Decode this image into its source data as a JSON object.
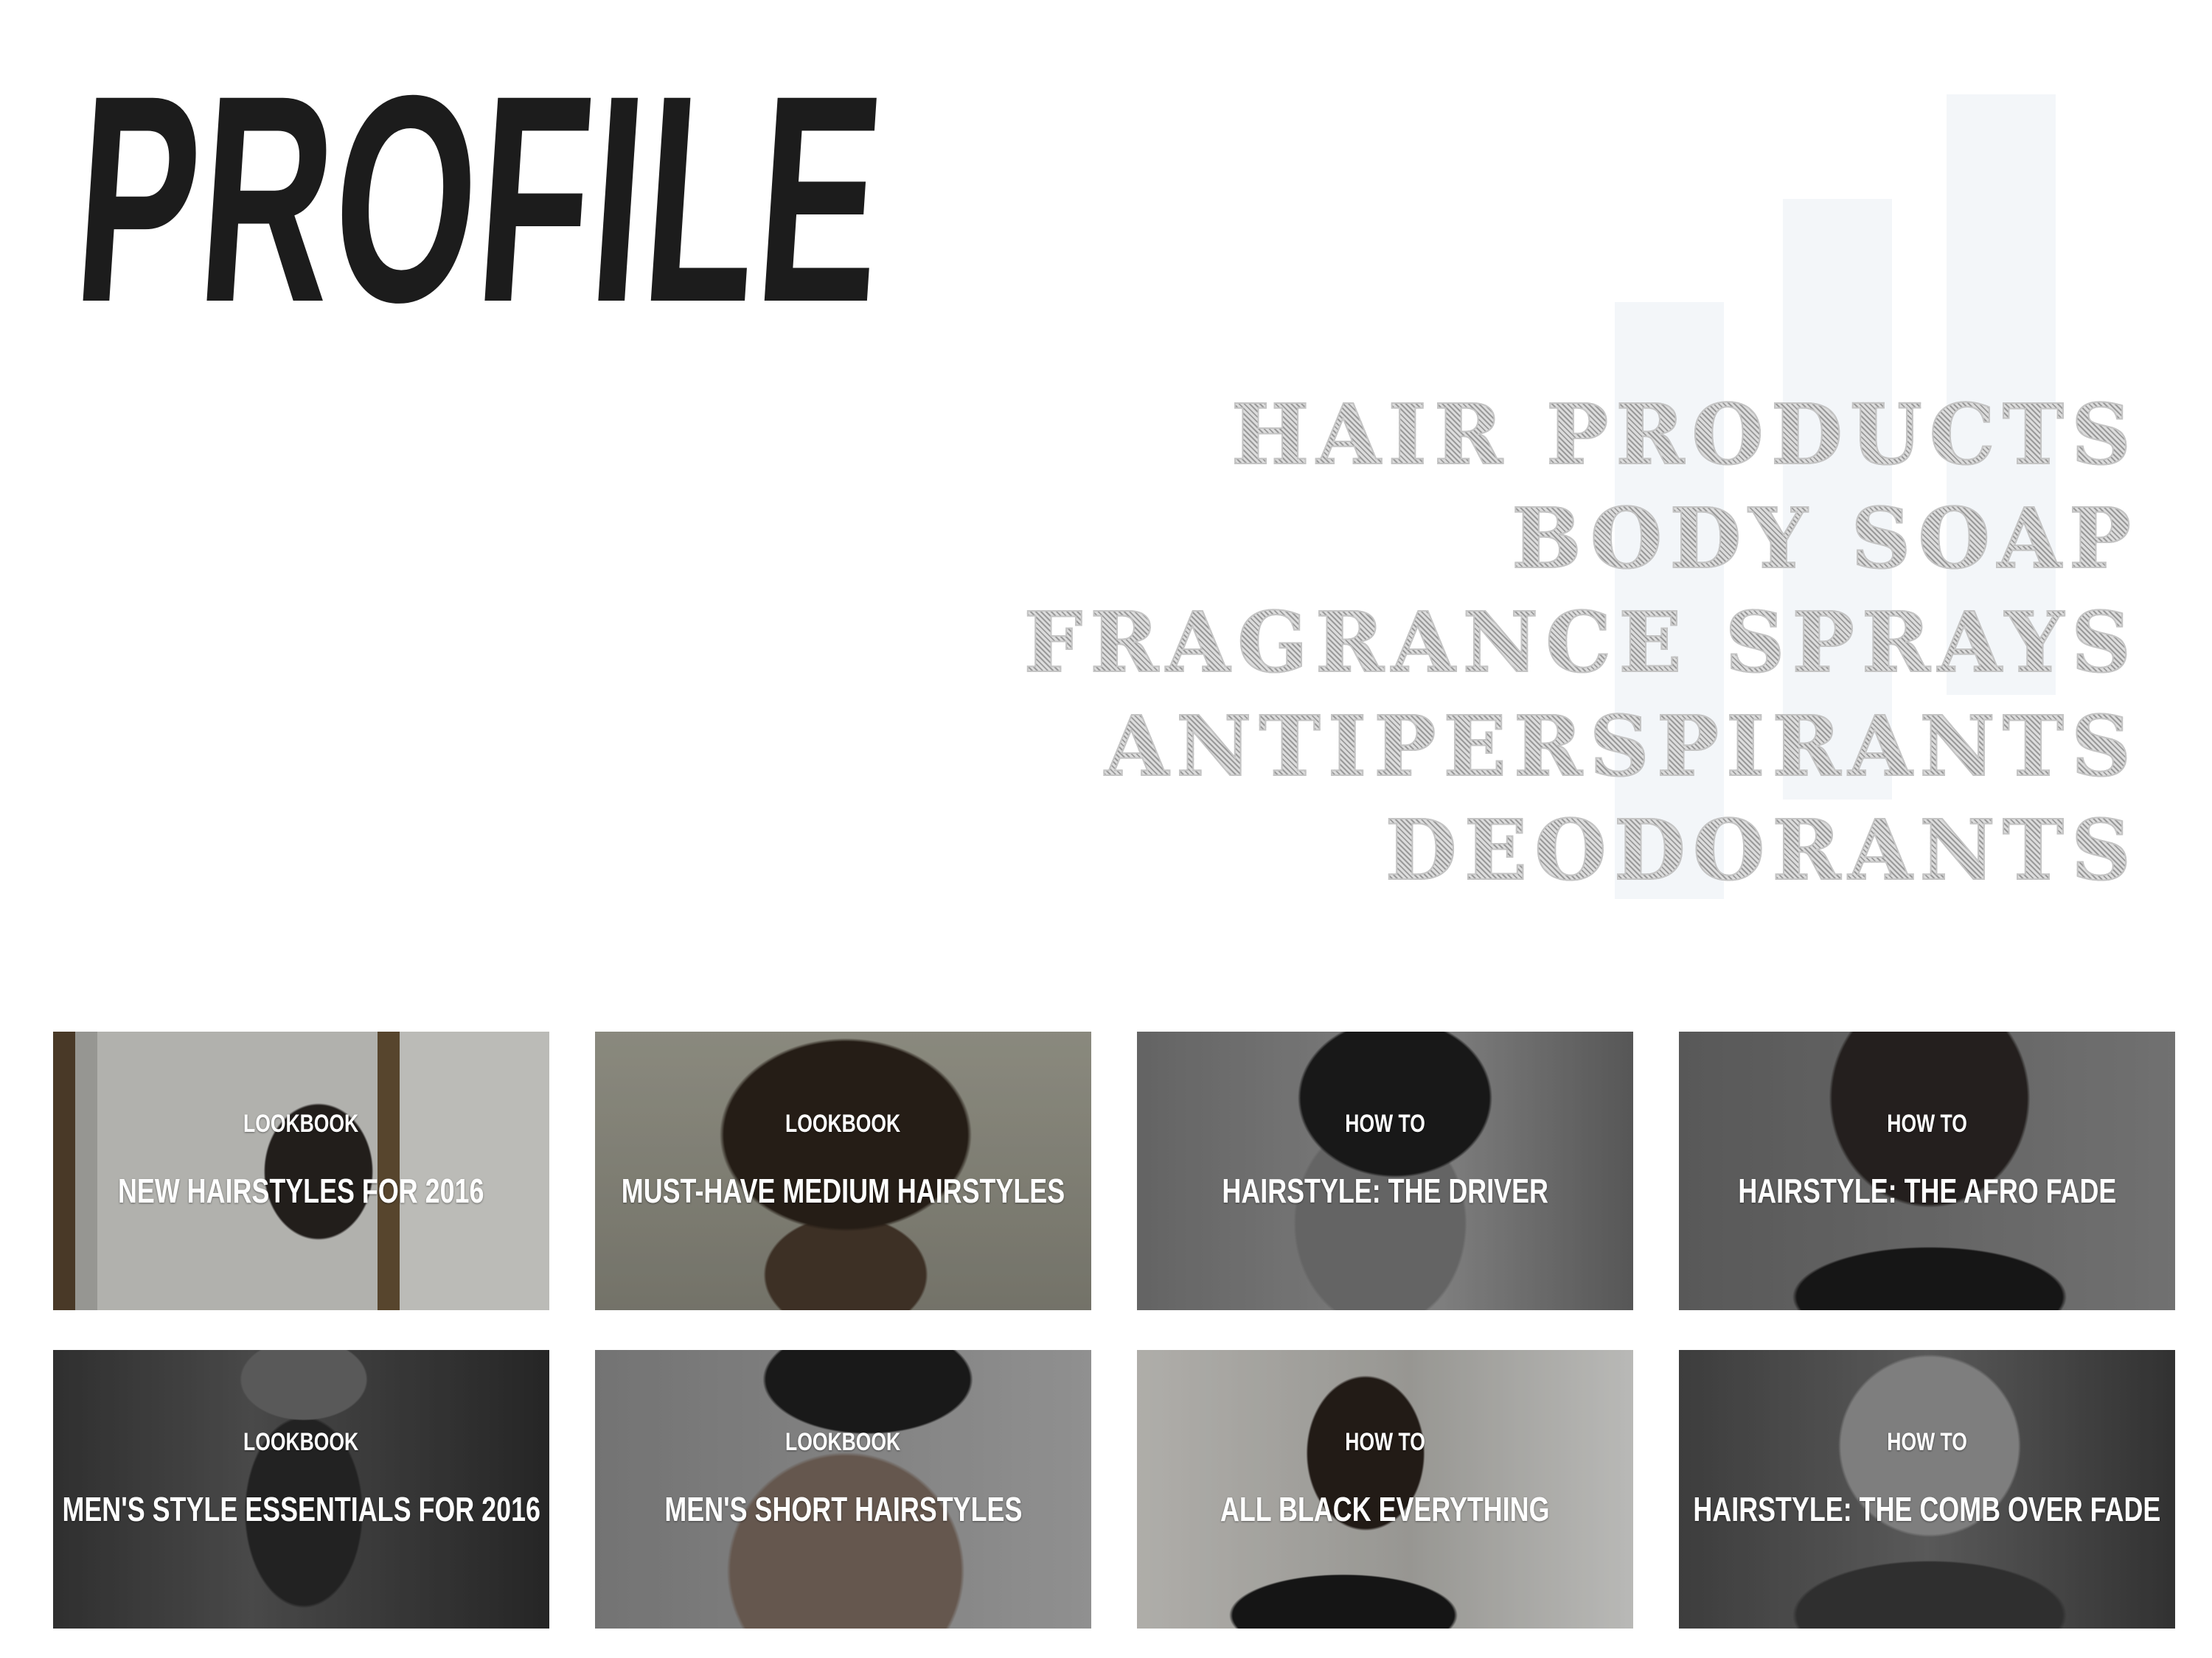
{
  "page": {
    "title": "PROFILE"
  },
  "categories": [
    "HAIR PRODUCTS",
    "BODY SOAP",
    "FRAGRANCE SPRAYS",
    "ANTIPERSPIRANTS",
    "DEODORANTS"
  ],
  "cards": [
    {
      "category": "LOOKBOOK",
      "title": "NEW HAIRSTYLES FOR 2016"
    },
    {
      "category": "LOOKBOOK",
      "title": "MUST-HAVE MEDIUM HAIRSTYLES"
    },
    {
      "category": "HOW TO",
      "title": "HAIRSTYLE: THE DRIVER"
    },
    {
      "category": "HOW TO",
      "title": "HAIRSTYLE: THE AFRO FADE"
    },
    {
      "category": "LOOKBOOK",
      "title": "MEN'S STYLE ESSENTIALS FOR 2016"
    },
    {
      "category": "LOOKBOOK",
      "title": "MEN'S SHORT HAIRSTYLES"
    },
    {
      "category": "HOW TO",
      "title": "ALL BLACK EVERYTHING"
    },
    {
      "category": "HOW TO",
      "title": "HAIRSTYLE: THE COMB OVER FADE"
    }
  ],
  "colors": {
    "title": "#1c1c1c",
    "decorative_bars": "#f3f6f9",
    "category_text": "#c4c4c4",
    "card_text": "#ffffff"
  }
}
